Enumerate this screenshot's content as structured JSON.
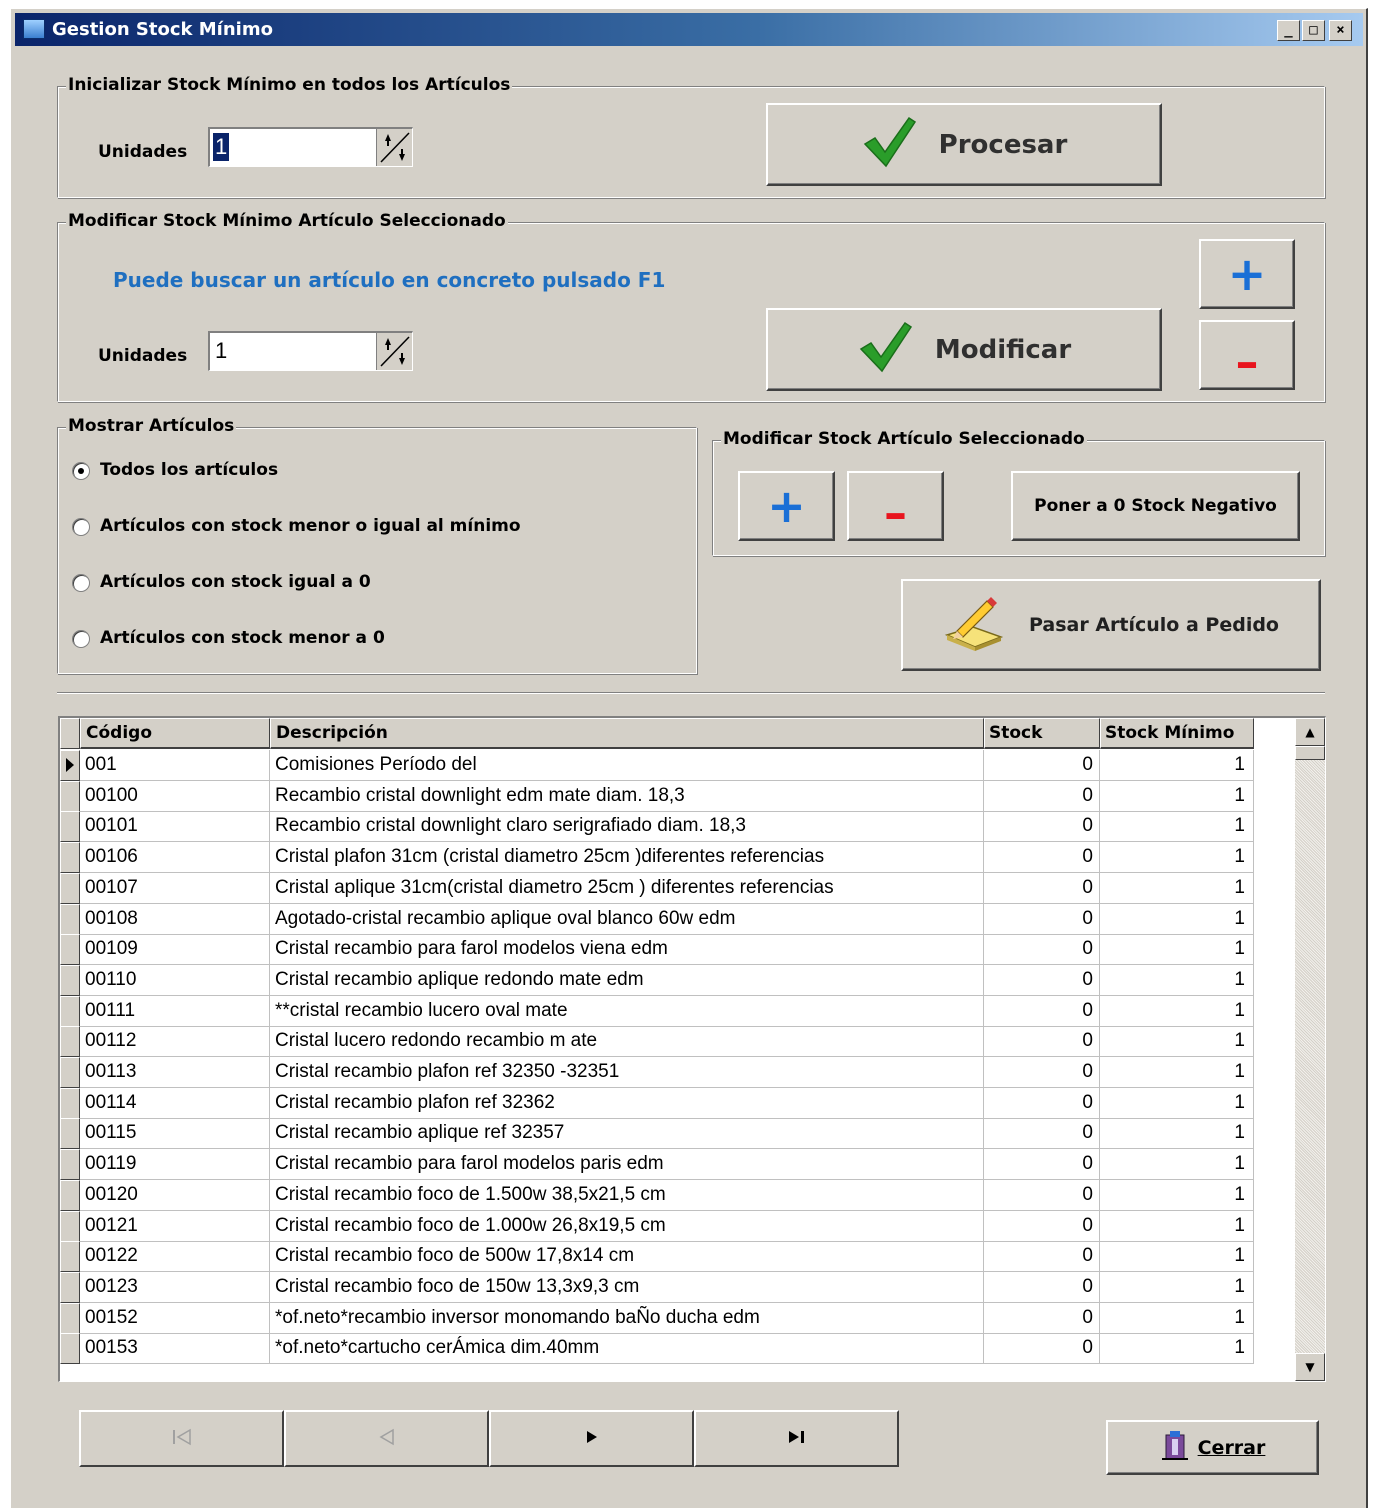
{
  "window": {
    "title": "Gestion Stock Mínimo",
    "controls": {
      "minimize": "_",
      "maximize": "□",
      "close": "×"
    }
  },
  "init_group": {
    "title": "Inicializar Stock Mínimo en todos los Artículos",
    "units_label": "Unidades",
    "units_value": "1",
    "process_button": "Procesar"
  },
  "modify_min_group": {
    "title": "Modificar Stock Mínimo Artículo Seleccionado",
    "hint": "Puede buscar un artículo en concreto pulsado F1",
    "units_label": "Unidades",
    "units_value": "1",
    "modify_button": "Modificar",
    "plus_label": "+",
    "minus_label": "–"
  },
  "filter_group": {
    "title": "Mostrar Artículos",
    "options": [
      {
        "label": "Todos los artículos",
        "checked": true
      },
      {
        "label": "Artículos con stock menor o igual al mínimo",
        "checked": false
      },
      {
        "label": "Artículos con stock igual a 0",
        "checked": false
      },
      {
        "label": "Artículos con stock menor a 0",
        "checked": false
      }
    ]
  },
  "stock_group": {
    "title": "Modificar Stock Artículo Seleccionado",
    "plus_label": "+",
    "minus_label": "–",
    "zero_negative_button": "Poner a 0 Stock Negativo"
  },
  "order_button": "Pasar Artículo a Pedido",
  "grid": {
    "columns": [
      "Código",
      "Descripción",
      "Stock",
      "Stock Mínimo"
    ],
    "rows": [
      [
        "001",
        "Comisiones Período del",
        "0",
        "1"
      ],
      [
        "00100",
        "Recambio cristal downlight edm mate diam. 18,3",
        "0",
        "1"
      ],
      [
        "00101",
        "Recambio cristal downlight claro serigrafiado diam. 18,3",
        "0",
        "1"
      ],
      [
        "00106",
        "Cristal plafon 31cm (cristal diametro 25cm )diferentes referencias",
        "0",
        "1"
      ],
      [
        "00107",
        "Cristal aplique 31cm(cristal diametro 25cm ) diferentes referencias",
        "0",
        "1"
      ],
      [
        "00108",
        "Agotado-cristal recambio aplique oval blanco 60w edm",
        "0",
        "1"
      ],
      [
        "00109",
        "Cristal recambio para farol modelos viena edm",
        "0",
        "1"
      ],
      [
        "00110",
        "Cristal recambio aplique redondo mate edm",
        "0",
        "1"
      ],
      [
        "00111",
        "**cristal recambio lucero oval mate",
        "0",
        "1"
      ],
      [
        "00112",
        "Cristal lucero redondo recambio m ate",
        "0",
        "1"
      ],
      [
        "00113",
        "Cristal recambio plafon ref 32350 -32351",
        "0",
        "1"
      ],
      [
        "00114",
        "Cristal recambio plafon ref 32362",
        "0",
        "1"
      ],
      [
        "00115",
        "Cristal recambio aplique ref 32357",
        "0",
        "1"
      ],
      [
        "00119",
        "Cristal recambio para farol modelos paris edm",
        "0",
        "1"
      ],
      [
        "00120",
        "Cristal recambio foco de 1.500w 38,5x21,5 cm",
        "0",
        "1"
      ],
      [
        "00121",
        "Cristal recambio foco de 1.000w 26,8x19,5 cm",
        "0",
        "1"
      ],
      [
        "00122",
        "Cristal recambio foco de 500w 17,8x14 cm",
        "0",
        "1"
      ],
      [
        "00123",
        "Cristal recambio foco de 150w 13,3x9,3 cm",
        "0",
        "1"
      ],
      [
        "00152",
        "*of.neto*recambio inversor monomando baÑo ducha edm",
        "0",
        "1"
      ],
      [
        "00153",
        "*of.neto*cartucho cerÁmica dim.40mm",
        "0",
        "1"
      ]
    ]
  },
  "nav": {
    "first_icon": "first-record-icon",
    "prev_icon": "previous-record-icon",
    "next_icon": "next-record-icon",
    "last_icon": "last-record-icon"
  },
  "close_button": "Cerrar",
  "colors": {
    "window_bg": "#d4d0c8",
    "title_start": "#0a246a",
    "title_end": "#a6caf0",
    "hint_blue": "#1f6fc0",
    "plus_blue": "#1a6fd6",
    "minus_red": "#e8141e",
    "check_green": "#2a9d2a"
  }
}
